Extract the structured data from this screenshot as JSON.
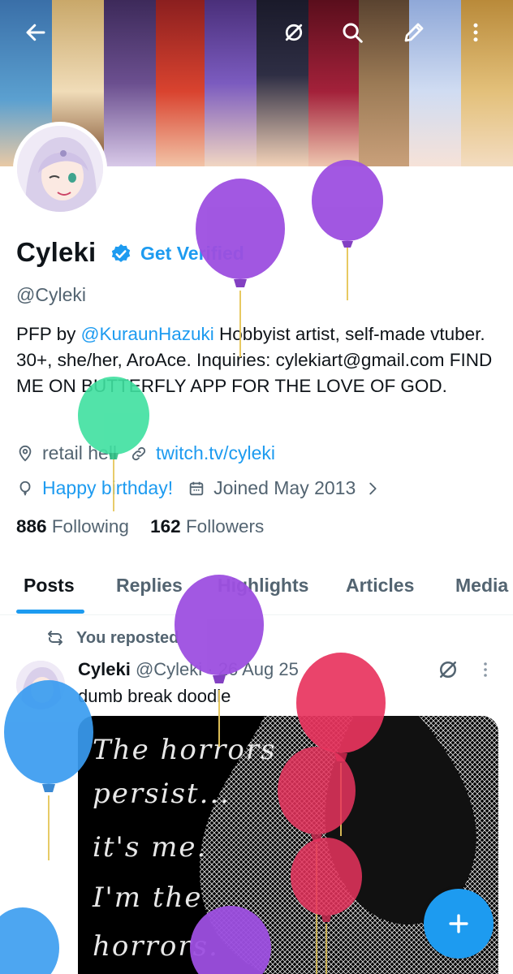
{
  "topbar": {
    "back_icon": "arrow-left-icon",
    "grok_icon": "grok-icon",
    "search_icon": "search-icon",
    "edit_icon": "pen-icon",
    "more_icon": "vertical-dots-icon"
  },
  "profile": {
    "name": "Cyleki",
    "get_verified": "Get Verified",
    "handle": "@Cyleki",
    "bio": {
      "p1": "PFP by ",
      "mention": "@KuraunHazuki",
      "p2": " Hobbyist artist, self-made vtuber.  30+, she/her, AroAce. Inquiries: cylekiart@gmail.com FIND ME ON BUTTERFLY APP FOR THE LOVE OF GOD."
    },
    "location": "retail hell",
    "website": "twitch.tv/cyleki",
    "birthday": "Happy birthday!",
    "joined": "Joined May 2013",
    "following_count": "886",
    "following_label": "Following",
    "followers_count": "162",
    "followers_label": "Followers"
  },
  "tabs": [
    "Posts",
    "Replies",
    "Highlights",
    "Articles",
    "Media"
  ],
  "post": {
    "repost_label": "You reposted",
    "author": "Cyleki",
    "handle_time": "@Cyleki · 26 Aug 25",
    "text": "dumb break doodle",
    "image_lines": [
      "The horrors",
      "persist...",
      "it's me.",
      "I'm the",
      "horrors."
    ]
  },
  "colors": {
    "accent": "#1d9bf0",
    "text": "#0f1419",
    "secondary": "#536471"
  },
  "fab_icon": "plus-icon"
}
